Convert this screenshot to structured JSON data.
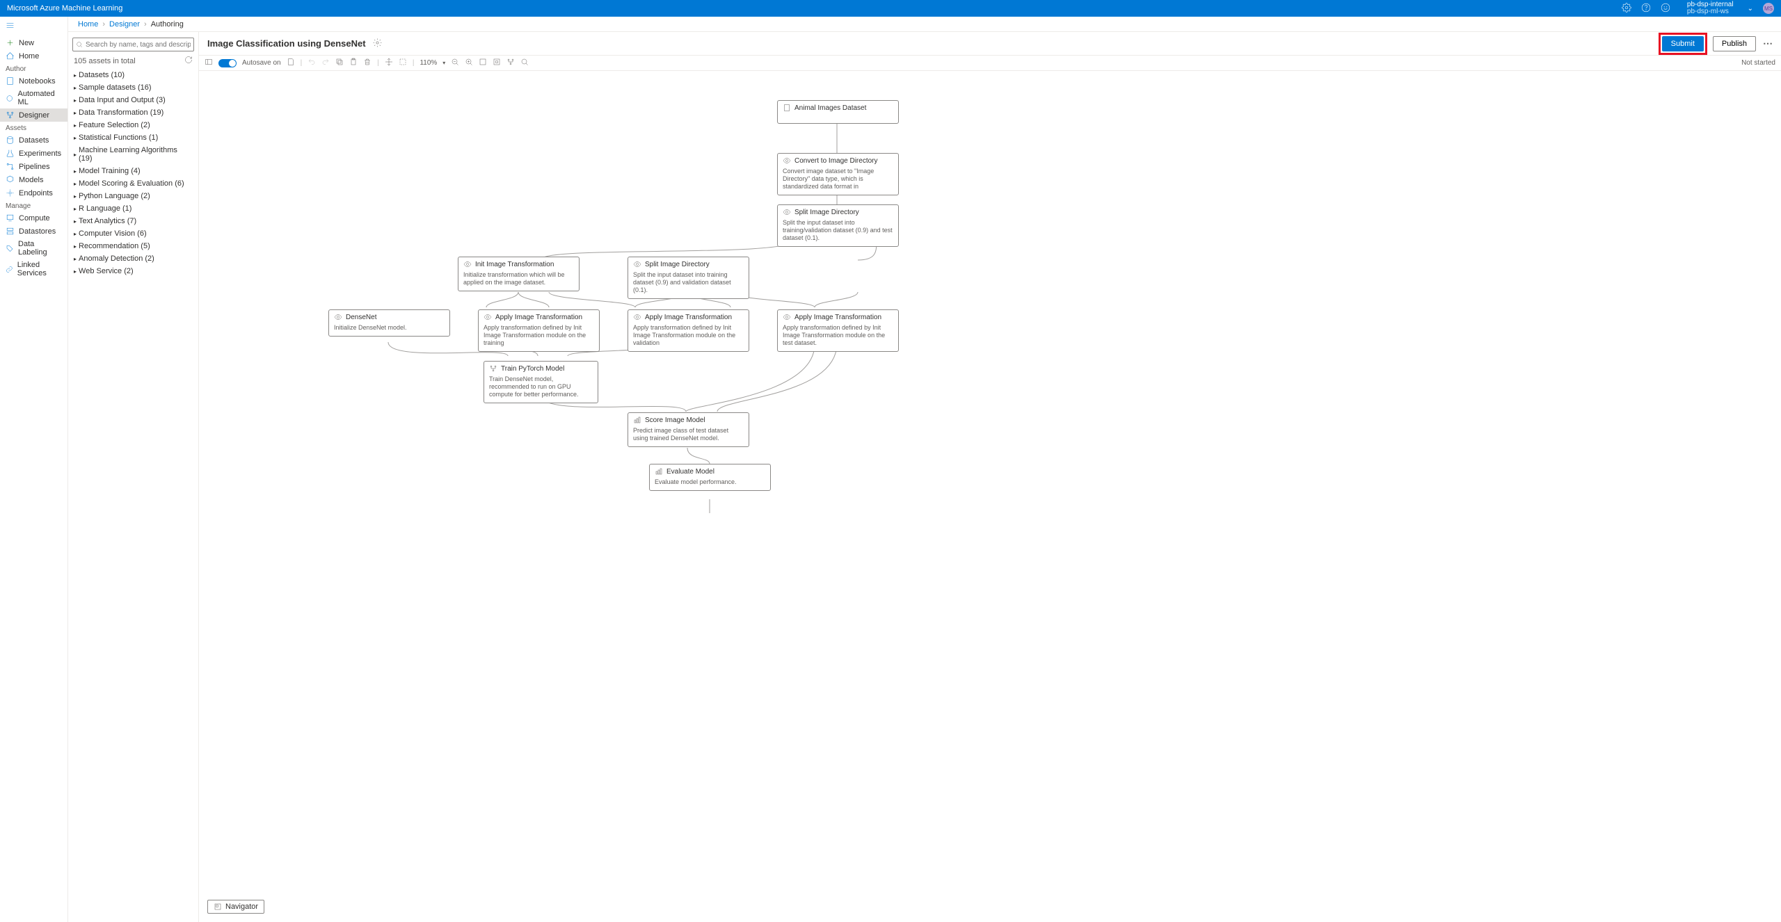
{
  "topbar": {
    "product": "Microsoft Azure Machine Learning",
    "workspace_top": "pb-dsp-internal",
    "workspace_bottom": "pb-dsp-ml-ws",
    "avatar_initials": "MS"
  },
  "breadcrumb": {
    "home": "Home",
    "designer": "Designer",
    "authoring": "Authoring"
  },
  "leftnav": {
    "new": "New",
    "home": "Home",
    "section_author": "Author",
    "notebooks": "Notebooks",
    "automl": "Automated ML",
    "designer": "Designer",
    "section_assets": "Assets",
    "datasets": "Datasets",
    "experiments": "Experiments",
    "pipelines": "Pipelines",
    "models": "Models",
    "endpoints": "Endpoints",
    "section_manage": "Manage",
    "compute": "Compute",
    "datastores": "Datastores",
    "datalabeling": "Data Labeling",
    "linked": "Linked Services"
  },
  "search": {
    "placeholder": "Search by name, tags and description"
  },
  "assets": {
    "count_label": "105 assets in total",
    "categories": [
      "Datasets (10)",
      "Sample datasets (16)",
      "Data Input and Output (3)",
      "Data Transformation (19)",
      "Feature Selection (2)",
      "Statistical Functions (1)",
      "Machine Learning Algorithms (19)",
      "Model Training (4)",
      "Model Scoring & Evaluation (6)",
      "Python Language (2)",
      "R Language (1)",
      "Text Analytics (7)",
      "Computer Vision (6)",
      "Recommendation (5)",
      "Anomaly Detection (2)",
      "Web Service (2)"
    ]
  },
  "pipeline": {
    "title": "Image Classification using DenseNet"
  },
  "buttons": {
    "submit": "Submit",
    "publish": "Publish"
  },
  "toolbar": {
    "autosave": "Autosave on",
    "zoom": "110%",
    "status": "Not started"
  },
  "nodes": {
    "animal": {
      "title": "Animal Images Dataset"
    },
    "convert": {
      "title": "Convert to Image Directory",
      "desc": "Convert image dataset to \"Image Directory\" data type, which is standardized data format in"
    },
    "split1": {
      "title": "Split Image Directory",
      "desc": "Split the input dataset into training/validation dataset (0.9) and test dataset (0.1)."
    },
    "init": {
      "title": "Init Image Transformation",
      "desc": "Initialize transformation which will be applied on the image dataset."
    },
    "split2": {
      "title": "Split Image Directory",
      "desc": "Split the input dataset into training dataset (0.9) and validation dataset (0.1)."
    },
    "dense": {
      "title": "DenseNet",
      "desc": "Initialize DenseNet model."
    },
    "apply1": {
      "title": "Apply Image Transformation",
      "desc": "Apply transformation defined by Init Image Transformation module on the training"
    },
    "apply2": {
      "title": "Apply Image Transformation",
      "desc": "Apply transformation defined by Init Image Transformation module on the validation"
    },
    "apply3": {
      "title": "Apply Image Transformation",
      "desc": "Apply transformation defined by Init Image Transformation module on the test dataset."
    },
    "train": {
      "title": "Train PyTorch Model",
      "desc": "Train DenseNet model, recommended to run on GPU compute for better performance."
    },
    "score": {
      "title": "Score Image Model",
      "desc": "Predict image class of test dataset using trained DenseNet model."
    },
    "eval": {
      "title": "Evaluate Model",
      "desc": "Evaluate model performance."
    }
  },
  "navigator": "Navigator"
}
